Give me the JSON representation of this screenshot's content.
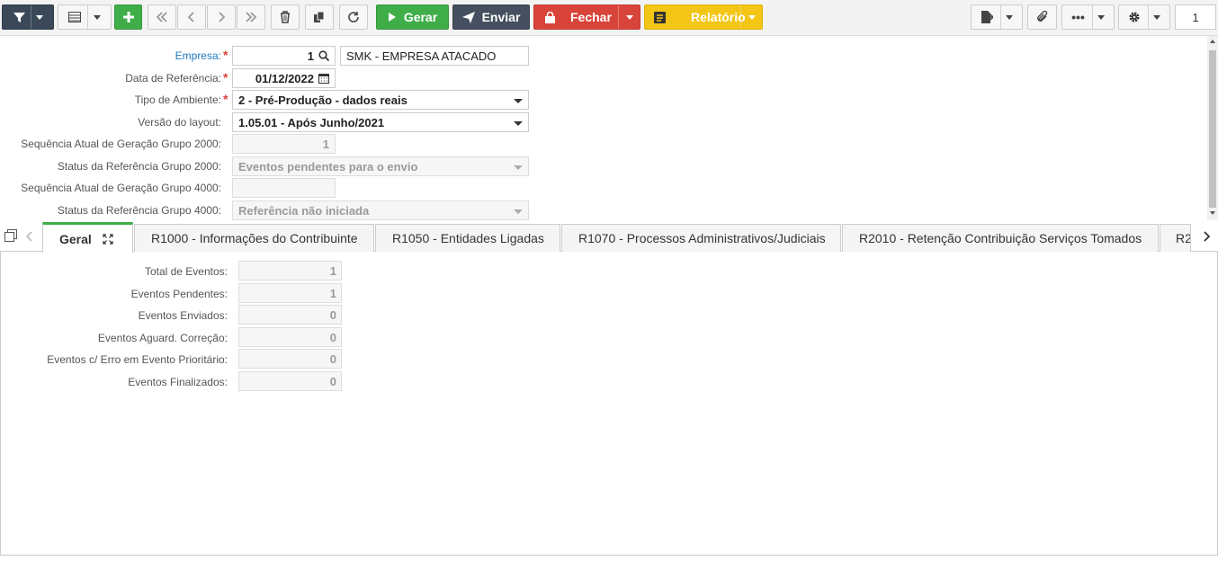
{
  "toolbar": {
    "gerar_label": "Gerar",
    "enviar_label": "Enviar",
    "fechar_label": "Fechar",
    "relatorio_label": "Relatório",
    "page_number": "1"
  },
  "form": {
    "empresa": {
      "label": "Empresa:",
      "code": "1",
      "name": "SMK - EMPRESA ATACADO"
    },
    "data_referencia": {
      "label": "Data de Referência:",
      "value": "01/12/2022"
    },
    "tipo_ambiente": {
      "label": "Tipo de Ambiente:",
      "value": "2 - Pré-Produção - dados reais"
    },
    "versao_layout": {
      "label": "Versão do layout:",
      "value": "1.05.01 - Após Junho/2021"
    },
    "seq_2000": {
      "label": "Sequência Atual de Geração Grupo 2000:",
      "value": "1"
    },
    "status_2000": {
      "label": "Status da Referência Grupo 2000:",
      "value": "Eventos pendentes para o envio"
    },
    "seq_4000": {
      "label": "Sequência Atual de Geração Grupo 4000:",
      "value": ""
    },
    "status_4000": {
      "label": "Status da Referência Grupo 4000:",
      "value": "Referência não iniciada"
    }
  },
  "tabs": [
    {
      "label": "Geral"
    },
    {
      "label": "R1000 - Informações do Contribuinte"
    },
    {
      "label": "R1050 - Entidades Ligadas"
    },
    {
      "label": "R1070 - Processos Administrativos/Judiciais"
    },
    {
      "label": "R2010 - Retenção Contribuição Serviços Tomados"
    },
    {
      "label": "R2"
    }
  ],
  "geral": {
    "rows": [
      {
        "label": "Total de Eventos:",
        "value": "1"
      },
      {
        "label": "Eventos Pendentes:",
        "value": "1"
      },
      {
        "label": "Eventos Enviados:",
        "value": "0"
      },
      {
        "label": "Eventos Aguard. Correção:",
        "value": "0"
      },
      {
        "label": "Eventos c/ Erro em Evento Prioritário:",
        "value": "0"
      },
      {
        "label": "Eventos Finalizados:",
        "value": "0"
      }
    ]
  },
  "colors": {
    "accent_green": "#3fae49",
    "danger_red": "#d9443a",
    "warning_yellow": "#f3c515",
    "link_blue": "#1f7cc1",
    "navy": "#44505f"
  }
}
